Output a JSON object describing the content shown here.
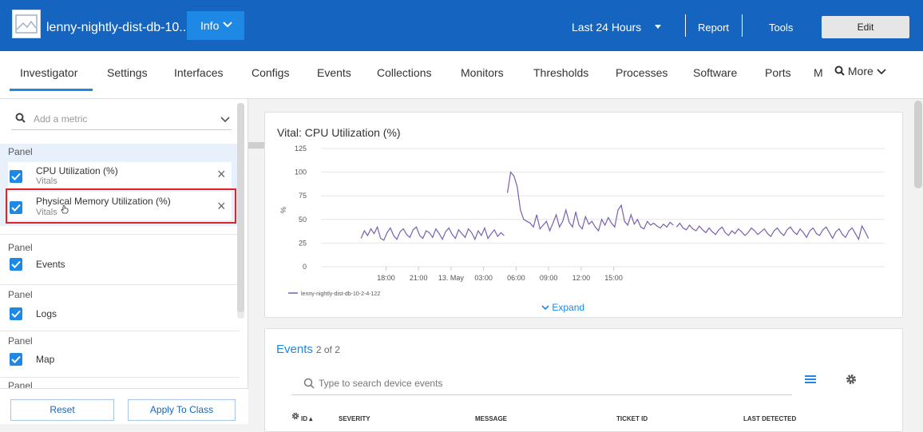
{
  "header": {
    "device_name": "lenny-nightly-dist-db-10...",
    "info_label": "Info",
    "time_range": "Last 24 Hours",
    "report_label": "Report",
    "tools_label": "Tools",
    "edit_label": "Edit",
    "bar_color": "#1565c0"
  },
  "tabs": [
    "Investigator",
    "Settings",
    "Interfaces",
    "Configs",
    "Events",
    "Collections",
    "Monitors",
    "Thresholds",
    "Processes",
    "Software",
    "Ports",
    "M"
  ],
  "active_tab": "Investigator",
  "more_label": "More",
  "left_panel": {
    "search_placeholder": "Add a metric",
    "panel_heading": "Panel",
    "metrics": [
      {
        "title": "CPU Utilization (%)",
        "sub": "Vitals"
      },
      {
        "title": "Physical Memory Utilization (%)",
        "sub": "Vitals"
      }
    ],
    "panels": [
      "Events",
      "Logs",
      "Map"
    ],
    "reset_label": "Reset",
    "apply_label": "Apply To Class"
  },
  "chart_data": {
    "type": "line",
    "title": "Vital: CPU Utilization (%)",
    "ylabel": "%",
    "ylim": [
      0,
      125
    ],
    "yticks": [
      0,
      25,
      50,
      75,
      100,
      125
    ],
    "xticks": [
      "18:00",
      "21:00",
      "13. May",
      "03:00",
      "06:00",
      "09:00",
      "12:00",
      "15:00"
    ],
    "legend": "lenny-nightly-dist-db-10-2-4-122",
    "series": [
      {
        "name": "lenny-nightly-dist-db-10-2-4-122",
        "color": "#7a5fb0",
        "segments": [
          {
            "x": [
              15.7,
              16.0,
              16.3,
              16.6,
              16.9,
              17.2,
              17.5,
              17.8,
              18.1,
              18.4,
              18.7,
              19.0,
              19.3,
              19.6,
              19.9,
              20.2,
              20.5,
              20.8,
              21.1,
              21.4,
              21.7,
              22.0,
              22.3,
              22.6,
              22.9,
              23.2,
              23.5,
              23.8,
              24.1,
              24.4,
              24.7,
              25.0,
              25.3,
              25.6,
              25.9,
              26.2,
              26.5,
              26.8,
              27.1,
              27.4,
              27.7,
              28.0,
              28.3,
              28.6,
              28.9
            ],
            "y": [
              30,
              38,
              33,
              40,
              35,
              42,
              30,
              28,
              36,
              41,
              33,
              29,
              37,
              40,
              34,
              31,
              39,
              42,
              33,
              30,
              38,
              36,
              31,
              40,
              35,
              29,
              37,
              41,
              34,
              30,
              39,
              35,
              31,
              40,
              36,
              29,
              38,
              33,
              41,
              30,
              35,
              39,
              32,
              36,
              33
            ]
          },
          {
            "x": [
              29.2,
              29.5,
              29.8,
              30.1,
              30.4,
              30.7,
              31.0,
              31.3,
              31.6,
              31.9,
              32.2,
              32.5,
              32.8,
              33.1,
              33.4,
              33.7,
              34.0,
              34.3,
              34.6,
              34.9,
              35.2,
              35.5,
              35.8,
              36.1,
              36.4,
              36.7,
              37.0,
              37.3,
              37.6,
              37.9,
              38.2,
              38.5,
              38.8,
              39.1,
              39.4,
              39.7,
              40.0,
              40.3,
              40.6,
              40.9,
              41.2,
              41.5,
              41.8,
              42.1,
              42.4,
              42.7,
              43.0,
              43.3,
              43.6,
              43.9,
              44.2,
              44.5
            ],
            "y": [
              78,
              100,
              96,
              85,
              60,
              50,
              48,
              46,
              42,
              55,
              40,
              44,
              48,
              38,
              46,
              55,
              42,
              48,
              60,
              47,
              42,
              58,
              44,
              40,
              53,
              45,
              48,
              42,
              38,
              50,
              44,
              52,
              46,
              42,
              60,
              65,
              48,
              44,
              55,
              45,
              50,
              42,
              40,
              48,
              44,
              46,
              43,
              41,
              45,
              42,
              47,
              44
            ]
          },
          {
            "x": [
              44.8,
              45.1,
              45.4,
              45.7,
              46.0,
              46.3,
              46.6,
              46.9,
              47.2,
              47.5,
              47.8,
              48.1,
              48.4,
              48.7,
              49.0,
              49.3,
              49.6,
              49.9,
              50.2,
              50.5,
              50.8,
              51.1,
              51.4,
              51.7,
              52.0,
              52.3,
              52.6,
              52.9,
              53.2,
              53.5,
              53.8,
              54.1,
              54.4,
              54.7,
              55.0,
              55.3,
              55.6,
              55.9,
              56.2,
              56.5,
              56.8,
              57.1,
              57.4,
              57.7,
              58.0,
              58.3,
              58.6,
              58.9,
              59.2,
              59.5,
              59.8,
              60.1,
              60.4,
              60.7,
              61.0,
              61.3,
              61.6,
              61.9,
              62.2,
              62.5
            ],
            "y": [
              42,
              46,
              41,
              39,
              44,
              40,
              38,
              43,
              39,
              36,
              41,
              37,
              34,
              39,
              42,
              36,
              33,
              38,
              35,
              40,
              37,
              33,
              36,
              41,
              38,
              34,
              37,
              40,
              35,
              32,
              38,
              41,
              36,
              33,
              39,
              42,
              37,
              34,
              40,
              36,
              31,
              38,
              41,
              35,
              33,
              39,
              42,
              36,
              30,
              37,
              40,
              34,
              31,
              38,
              41,
              35,
              29,
              43,
              37,
              30
            ]
          }
        ]
      }
    ]
  },
  "chart_card": {
    "expand_label": "Expand"
  },
  "events": {
    "title": "Events",
    "count": "2 of 2",
    "search_placeholder": "Type to search device events",
    "columns": [
      "ID",
      "SEVERITY",
      "MESSAGE",
      "TICKET ID",
      "LAST DETECTED"
    ]
  }
}
